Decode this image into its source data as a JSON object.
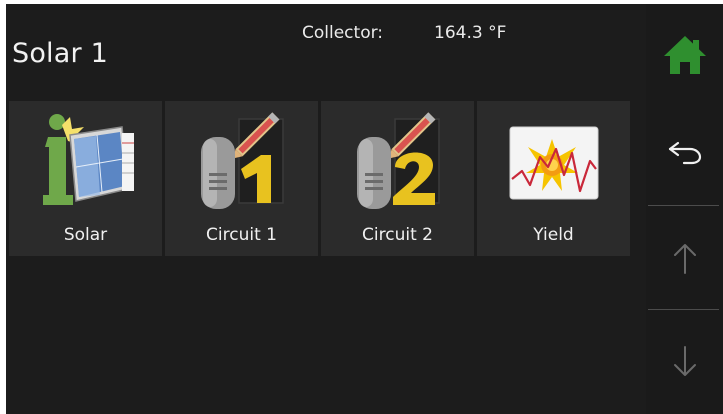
{
  "header": {
    "title": "Solar 1",
    "collector_label": "Collector:",
    "collector_value": "164.3 °F"
  },
  "tiles": [
    {
      "label": "Solar",
      "icon": "solar-panel-icon"
    },
    {
      "label": "Circuit 1",
      "icon": "tank-circuit-1-icon"
    },
    {
      "label": "Circuit 2",
      "icon": "tank-circuit-2-icon"
    },
    {
      "label": "Yield",
      "icon": "yield-chart-icon"
    }
  ],
  "sidebar": {
    "home_icon": "home-icon",
    "back_icon": "back-arrow-icon",
    "up_icon": "arrow-up-icon",
    "down_icon": "arrow-down-icon"
  },
  "colors": {
    "background": "#1c1c1c",
    "tile": "#2b2b2b",
    "home_green": "#2f8f2f",
    "digit_yellow": "#e8c21f",
    "plant_green": "#6fa84a"
  }
}
